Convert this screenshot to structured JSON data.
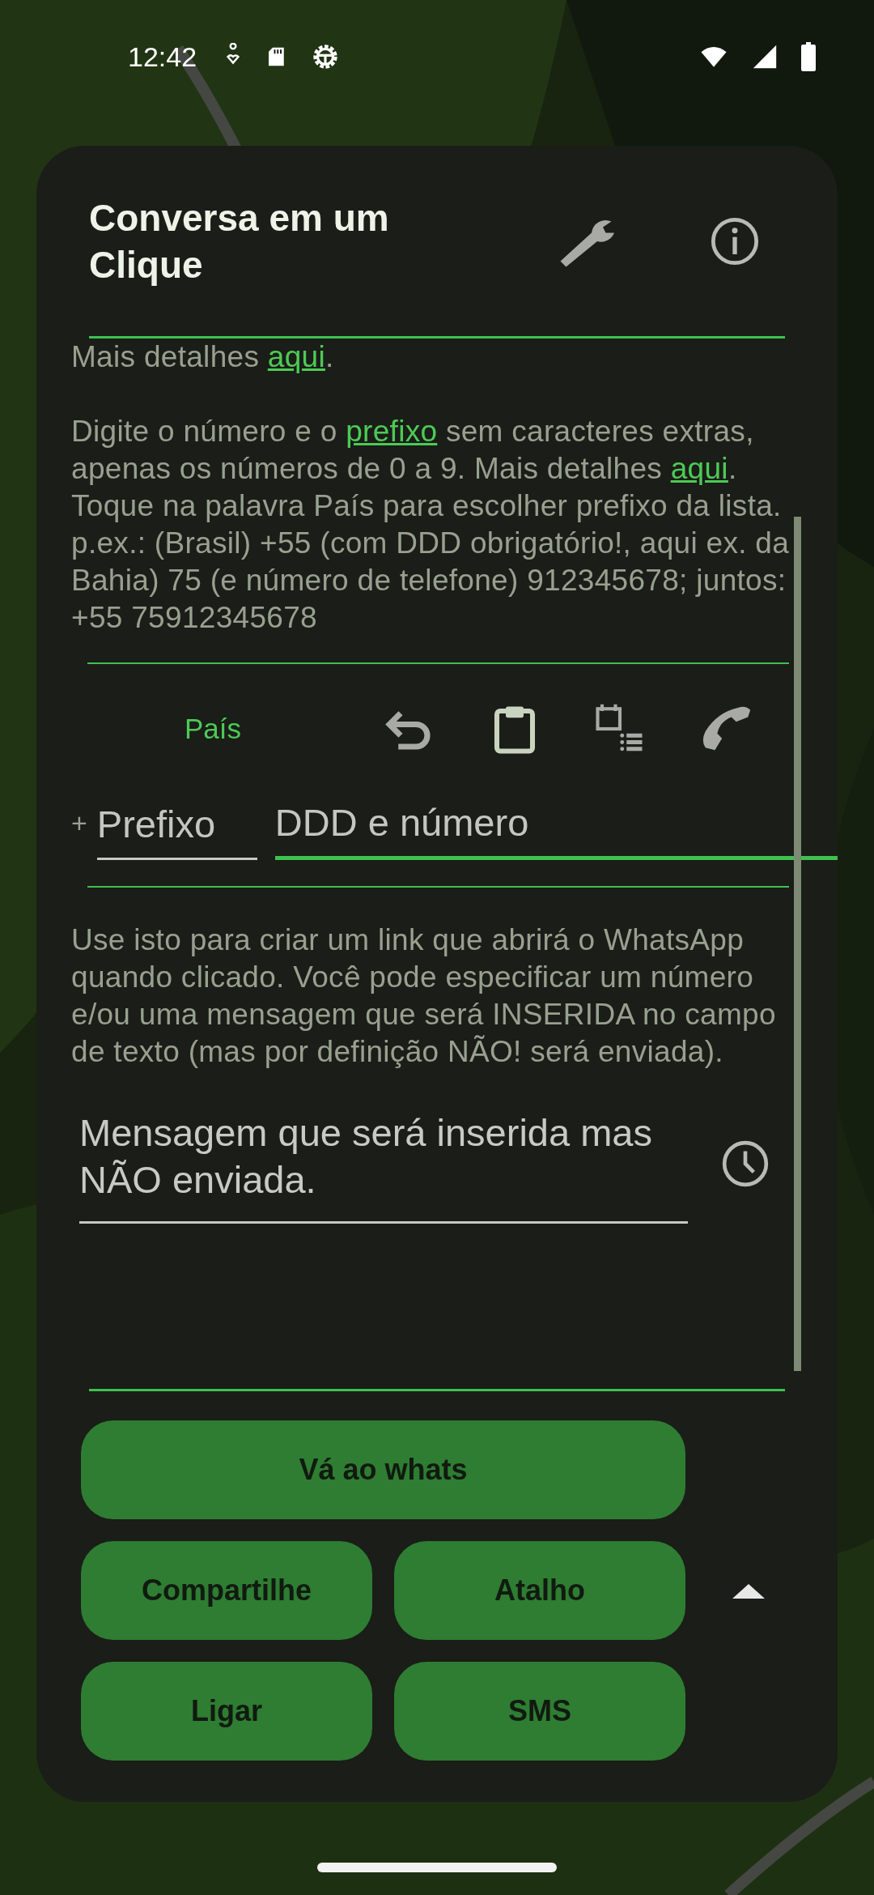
{
  "status_bar": {
    "time": "12:42"
  },
  "header": {
    "title": "Conversa em um Clique"
  },
  "intro": [
    {
      "text": "Mais detalhes ",
      "link": false
    },
    {
      "text": "aqui",
      "link": true
    },
    {
      "text": ".",
      "link": false
    }
  ],
  "instructions": [
    {
      "text": "Digite o número e o ",
      "link": false
    },
    {
      "text": "prefixo",
      "link": true
    },
    {
      "text": " sem caracteres extras, apenas os números de 0 a 9. Mais detalhes ",
      "link": false
    },
    {
      "text": "aqui",
      "link": true
    },
    {
      "text": ". Toque na palavra País para escolher prefixo da lista. p.ex.: (Brasil) +55 (com DDD obrigatório!, aqui ex. da Bahia) 75 (e número de telefone) 912345678; juntos: +55 75912345678",
      "link": false
    }
  ],
  "country_button": {
    "label": "País"
  },
  "prefix": {
    "symbol": "+",
    "placeholder": "Prefixo",
    "focused": false
  },
  "number": {
    "placeholder": "DDD e número",
    "focused": true
  },
  "description": "Use isto para criar um link que abrirá o WhatsApp quando clicado. Você pode especificar um número e/ou uma mensagem que será INSERIDA no campo de texto (mas por definição NÃO! será enviada).",
  "message": {
    "placeholder": "Mensagem que será inserida mas NÃO enviada."
  },
  "buttons": [
    {
      "label": "Vá ao whats",
      "wide": true
    },
    {
      "label": "Compartilhe",
      "wide": false
    },
    {
      "label": "Atalho",
      "wide": false
    },
    {
      "label": "Ligar",
      "wide": false
    },
    {
      "label": "SMS",
      "wide": false
    }
  ]
}
